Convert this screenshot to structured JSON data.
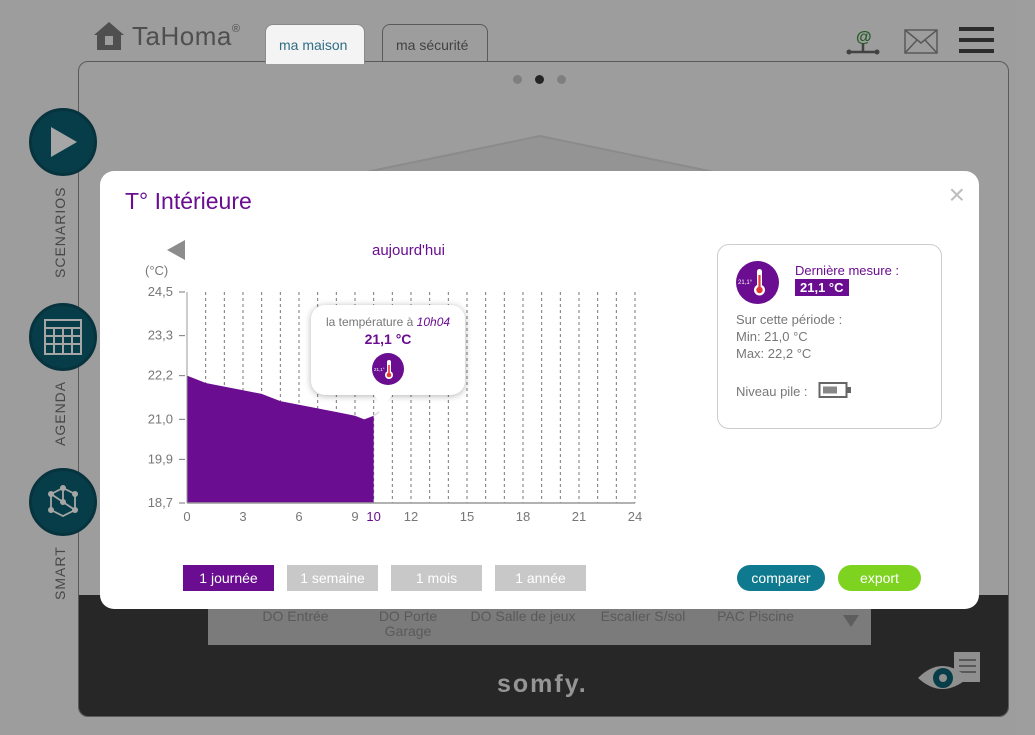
{
  "app": {
    "brand": "TaHoma",
    "brand_mark": "®",
    "tabs": [
      {
        "label": "ma maison"
      },
      {
        "label": "ma sécurité"
      }
    ],
    "side_menu": [
      {
        "label": "SCENARIOS"
      },
      {
        "label": "AGENDA"
      },
      {
        "label": "SMART"
      }
    ],
    "devices": [
      {
        "label": "DO Entrée"
      },
      {
        "label": "DO Porte Garage"
      },
      {
        "label": "DO Salle de jeux"
      },
      {
        "label": "Escalier S/sol"
      },
      {
        "label": "PAC Piscine"
      }
    ],
    "footer_brand": "somfy."
  },
  "modal": {
    "title": "T° Intérieure",
    "close": "×",
    "period_label": "aujourd'hui",
    "unit": "(°C)",
    "tooltip": {
      "prefix": "la température à ",
      "time": "10h04",
      "value": "21,1 °C",
      "icon_text": "21,1°"
    },
    "period_buttons": [
      {
        "label": "1 journée",
        "active": true
      },
      {
        "label": "1 semaine",
        "active": false
      },
      {
        "label": "1 mois",
        "active": false
      },
      {
        "label": "1 année",
        "active": false
      }
    ],
    "compare_label": "comparer",
    "export_label": "export",
    "info": {
      "icon_text": "21,1°",
      "last_label": "Dernière mesure :",
      "last_value": "21,1 °C",
      "period_title": "Sur cette période :",
      "min": "Min: 21,0 °C",
      "max": "Max: 22,2 °C",
      "battery_label": "Niveau pile :"
    }
  },
  "colors": {
    "primary": "#6a0d91",
    "teal": "#0c5f70",
    "compare": "#0f7a8f",
    "export": "#7ed321"
  },
  "chart_data": {
    "type": "area",
    "xlabel": "",
    "ylabel": "(°C)",
    "xlim": [
      0,
      24
    ],
    "ylim": [
      18.7,
      24.5
    ],
    "yticks": [
      "18,7",
      "19,9",
      "21,0",
      "22,2",
      "23,3",
      "24,5"
    ],
    "ytick_values": [
      18.7,
      19.9,
      21.0,
      22.2,
      23.3,
      24.5
    ],
    "xticks": [
      0,
      3,
      6,
      9,
      12,
      15,
      18,
      21,
      24
    ],
    "current_x": 10,
    "current_label": "10",
    "x": [
      0,
      1,
      2,
      3,
      4,
      5,
      6,
      7,
      8,
      9,
      9.5,
      10
    ],
    "y": [
      22.2,
      22.0,
      21.9,
      21.8,
      21.7,
      21.5,
      21.4,
      21.3,
      21.2,
      21.1,
      21.0,
      21.1
    ]
  }
}
